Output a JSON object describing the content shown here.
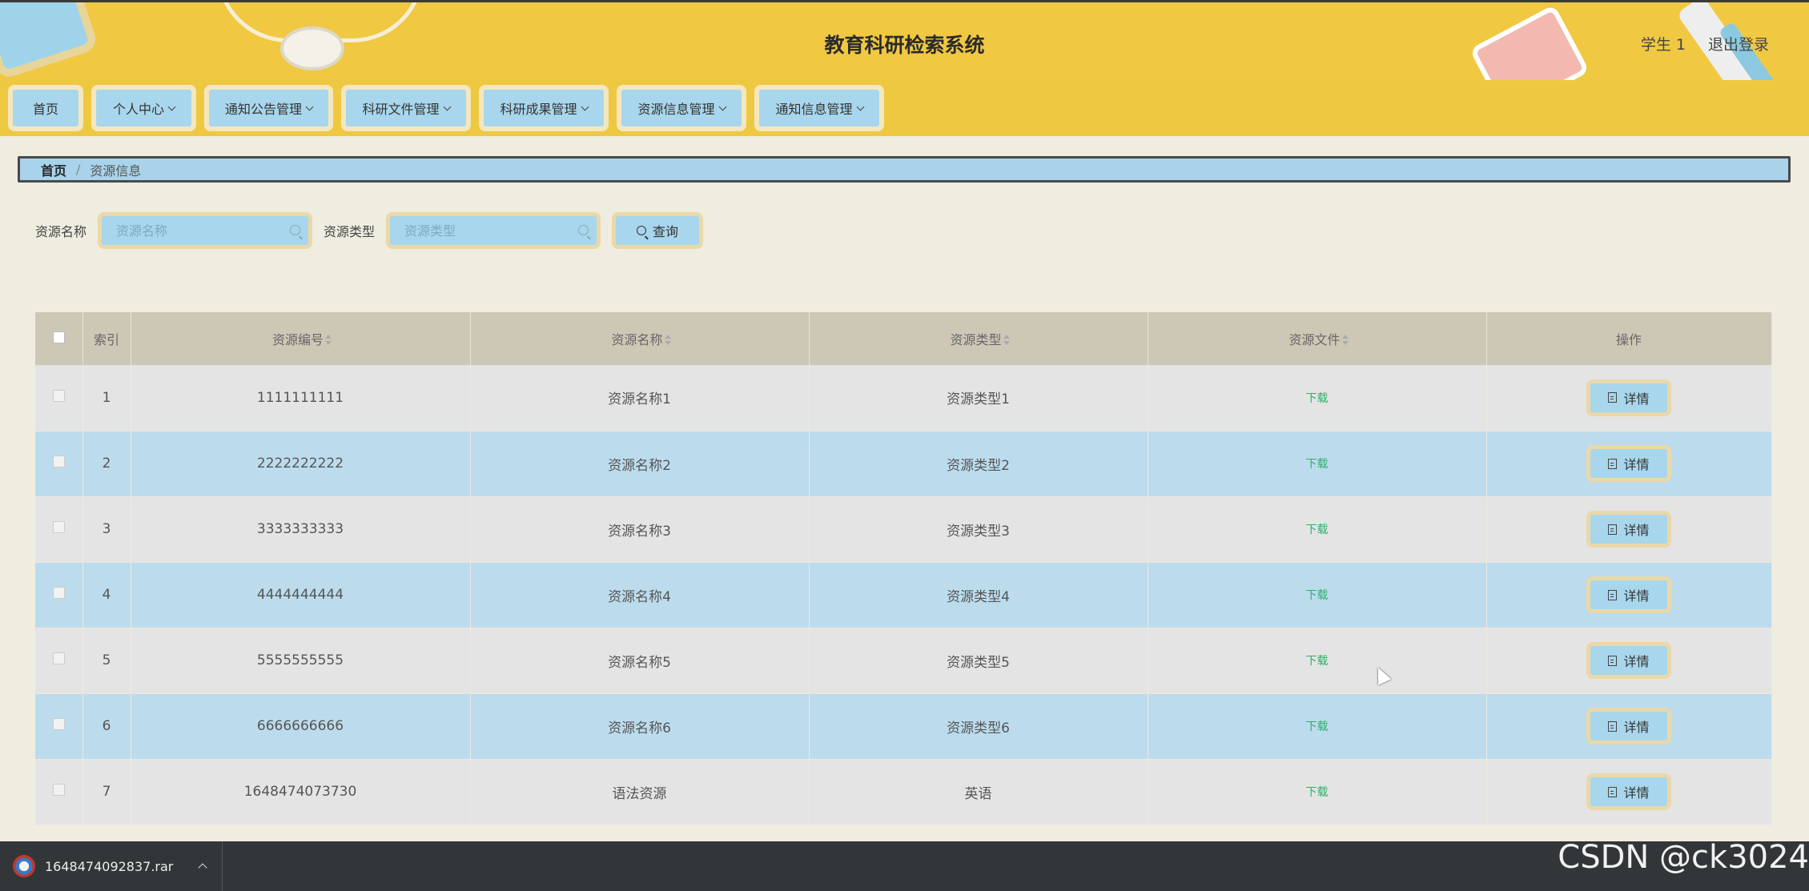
{
  "header": {
    "title": "教育科研检索系统",
    "user": "学生 1",
    "logout": "退出登录"
  },
  "nav": {
    "items": [
      {
        "label": "首页",
        "dropdown": false
      },
      {
        "label": "个人中心",
        "dropdown": true
      },
      {
        "label": "通知公告管理",
        "dropdown": true
      },
      {
        "label": "科研文件管理",
        "dropdown": true
      },
      {
        "label": "科研成果管理",
        "dropdown": true
      },
      {
        "label": "资源信息管理",
        "dropdown": true
      },
      {
        "label": "通知信息管理",
        "dropdown": true
      }
    ]
  },
  "breadcrumb": {
    "home": "首页",
    "separator": "/",
    "current": "资源信息"
  },
  "search": {
    "name_label": "资源名称",
    "name_placeholder": "资源名称",
    "type_label": "资源类型",
    "type_placeholder": "资源类型",
    "button": "查询"
  },
  "table": {
    "headers": {
      "index": "索引",
      "code": "资源编号",
      "name": "资源名称",
      "type": "资源类型",
      "file": "资源文件",
      "action": "操作"
    },
    "rows": [
      {
        "index": "1",
        "code": "1111111111",
        "name": "资源名称1",
        "type": "资源类型1",
        "file": "下载",
        "action": "详情"
      },
      {
        "index": "2",
        "code": "2222222222",
        "name": "资源名称2",
        "type": "资源类型2",
        "file": "下载",
        "action": "详情"
      },
      {
        "index": "3",
        "code": "3333333333",
        "name": "资源名称3",
        "type": "资源类型3",
        "file": "下载",
        "action": "详情"
      },
      {
        "index": "4",
        "code": "4444444444",
        "name": "资源名称4",
        "type": "资源类型4",
        "file": "下载",
        "action": "详情"
      },
      {
        "index": "5",
        "code": "5555555555",
        "name": "资源名称5",
        "type": "资源类型5",
        "file": "下载",
        "action": "详情"
      },
      {
        "index": "6",
        "code": "6666666666",
        "name": "资源名称6",
        "type": "资源类型6",
        "file": "下载",
        "action": "详情"
      },
      {
        "index": "7",
        "code": "1648474073730",
        "name": "语法资源",
        "type": "英语",
        "file": "下载",
        "action": "详情"
      }
    ]
  },
  "download_bar": {
    "filename": "1648474092837.rar"
  },
  "watermark": "CSDN @ck3024",
  "colors": {
    "header_bg": "#f0c842",
    "nav_button": "#a8d6ec",
    "row_alt": "#bcdced",
    "link_green": "#2fae6a"
  }
}
